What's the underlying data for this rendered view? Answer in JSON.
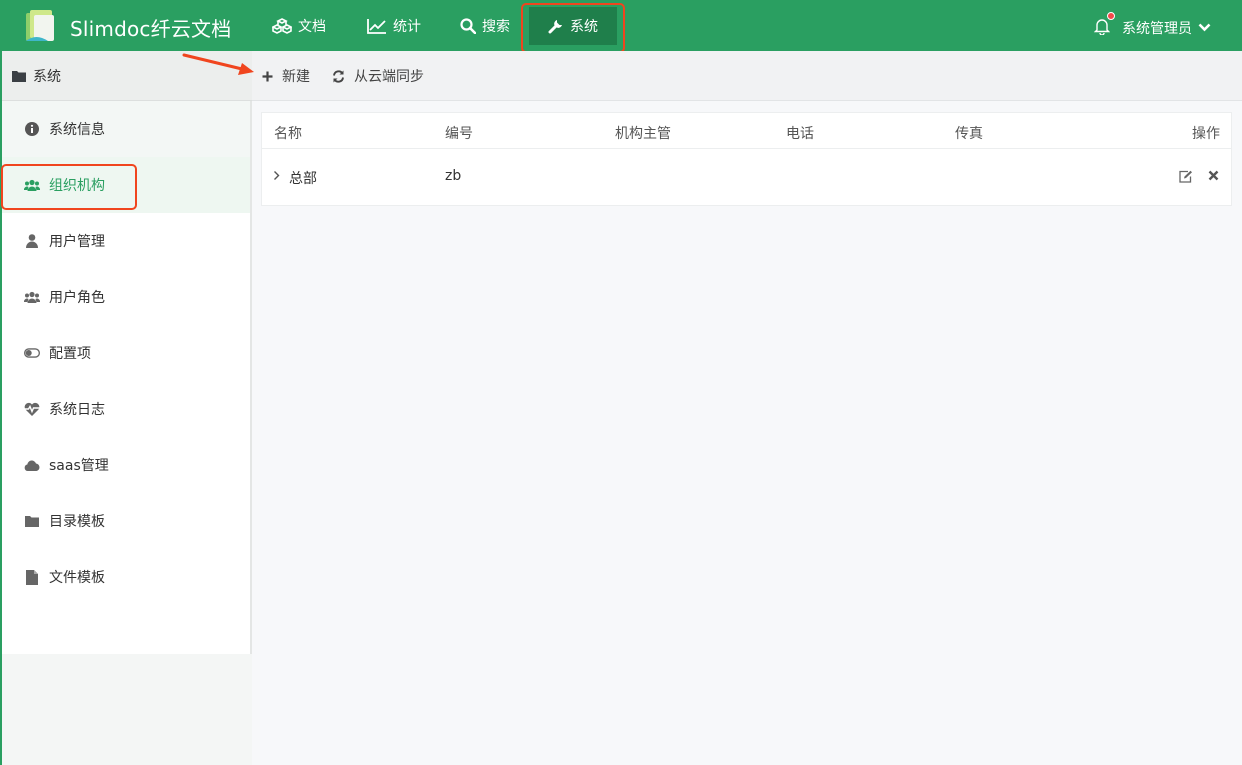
{
  "app": {
    "brand": "Slimdoc纤云文档"
  },
  "nav": {
    "docs": "文档",
    "stats": "统计",
    "search": "搜索",
    "system": "系统"
  },
  "user": {
    "name": "系统管理员"
  },
  "sidebar": {
    "title": "系统",
    "items": [
      {
        "label": "系统信息",
        "icon": "info-circle-icon"
      },
      {
        "label": "组织机构",
        "icon": "users-icon"
      },
      {
        "label": "用户管理",
        "icon": "user-icon"
      },
      {
        "label": "用户角色",
        "icon": "users-icon"
      },
      {
        "label": "配置项",
        "icon": "toggle-icon"
      },
      {
        "label": "系统日志",
        "icon": "heartbeat-icon"
      },
      {
        "label": "saas管理",
        "icon": "cloud-icon"
      },
      {
        "label": "目录模板",
        "icon": "folder-icon"
      },
      {
        "label": "文件模板",
        "icon": "file-icon"
      }
    ]
  },
  "toolbar": {
    "new_label": "新建",
    "sync_label": "从云端同步"
  },
  "table": {
    "columns": [
      "名称",
      "编号",
      "机构主管",
      "电话",
      "传真",
      "操作"
    ],
    "rows": [
      {
        "name": "总部",
        "code": "zb",
        "manager": "",
        "phone": "",
        "fax": ""
      }
    ]
  },
  "colors": {
    "brand": "#2a9f61",
    "highlight": "#f0451e"
  }
}
